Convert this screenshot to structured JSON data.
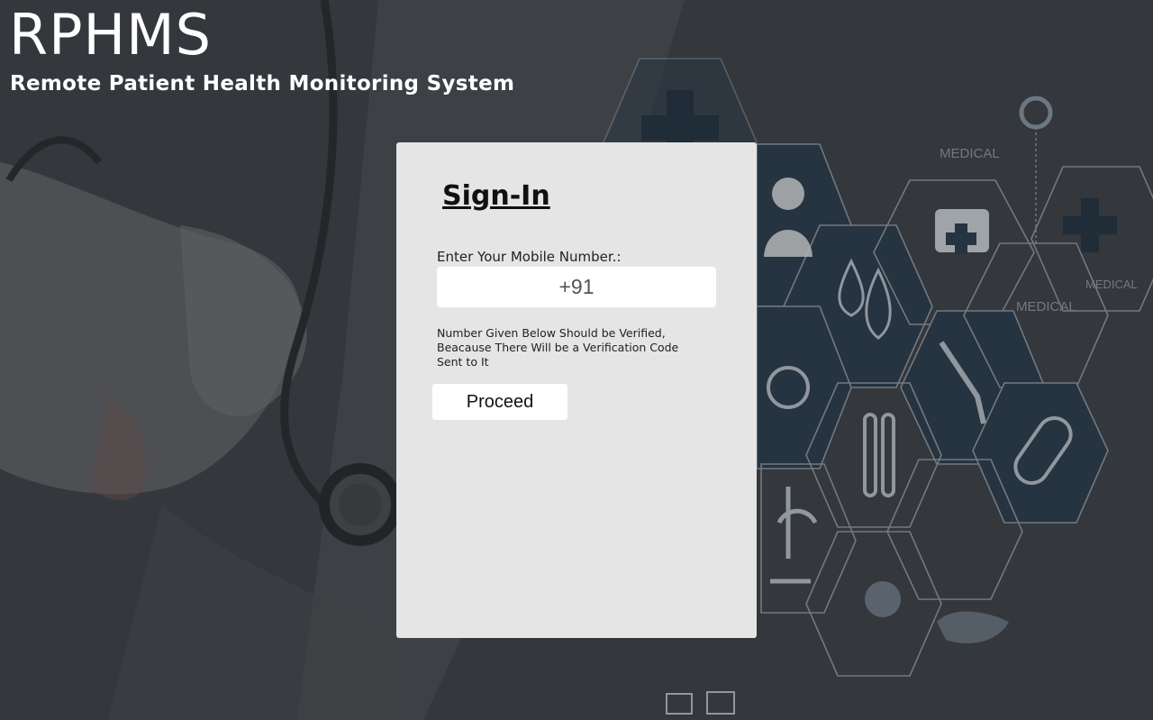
{
  "header": {
    "title": "RPHMS",
    "subtitle": "Remote Patient Health Monitoring System"
  },
  "background": {
    "hex_labels": [
      "MEDICAL",
      "MEDICAL",
      "MEDICAL"
    ]
  },
  "signin": {
    "title": "Sign-In",
    "mobile_label": "Enter Your Mobile Number.:",
    "mobile_placeholder": "+91",
    "note": "Number Given Below Should be Verified, Beacause There Will be a Verification Code Sent to It",
    "proceed_label": "Proceed"
  },
  "colors": {
    "background": "#3b3e42",
    "card": "#e5e5e5",
    "hex_fill": "#26384a",
    "hex_stroke": "#9aa3ab"
  }
}
